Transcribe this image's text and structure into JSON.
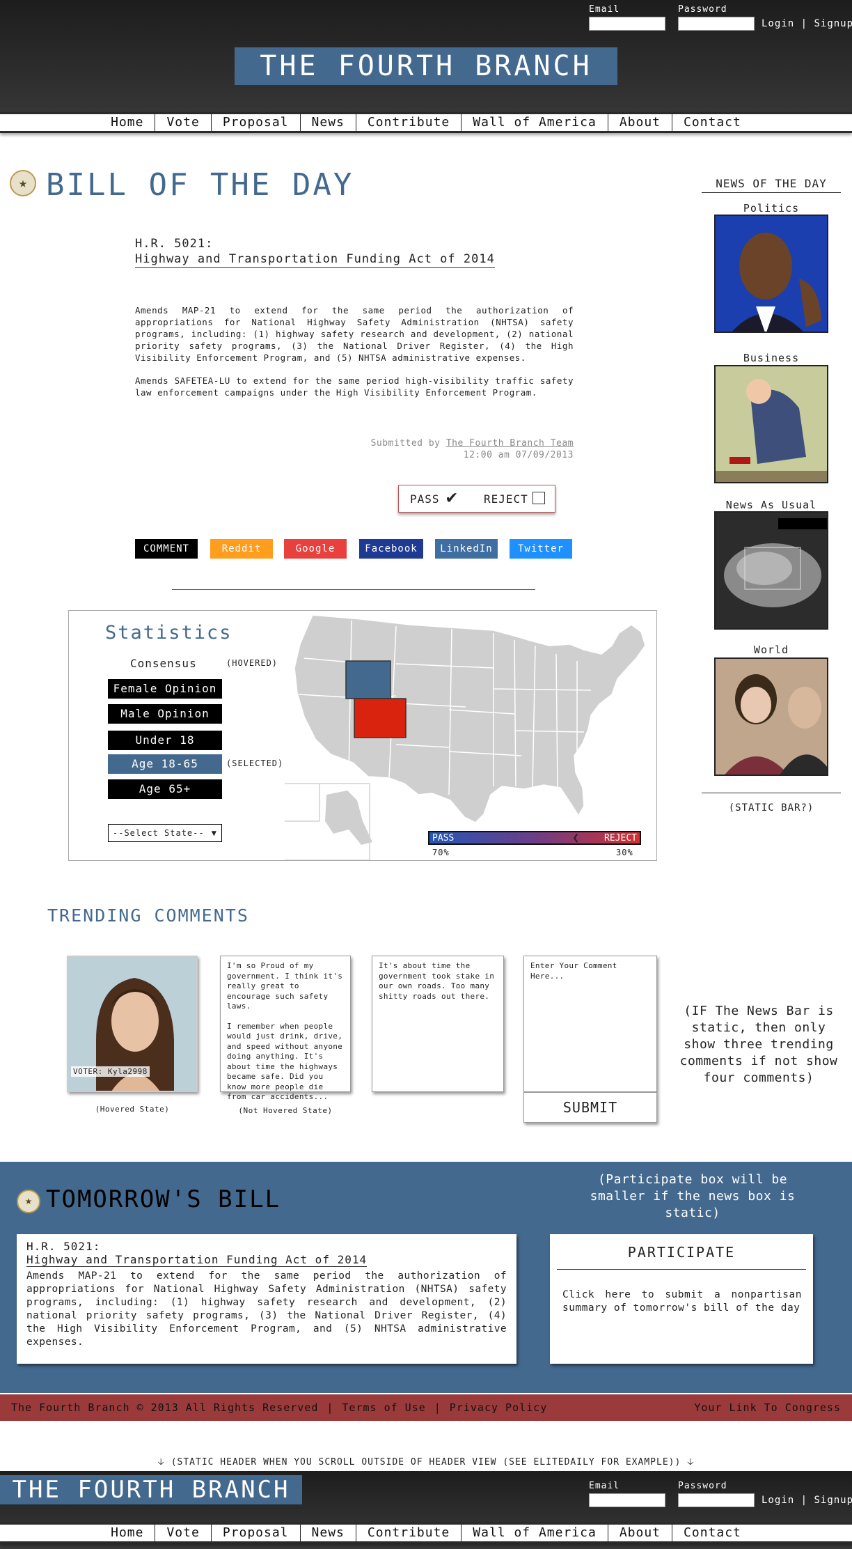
{
  "header": {
    "email_label": "Email",
    "password_label": "Password",
    "login_label": "Login",
    "separator": "|",
    "signup_label": "Signup",
    "logo": "THE FOURTH BRANCH"
  },
  "nav": [
    "Home",
    "Vote",
    "Proposal",
    "News",
    "Contribute",
    "Wall of America",
    "About",
    "Contact"
  ],
  "bill_of_day": {
    "title": "BILL OF THE DAY",
    "number": "H.R. 5021:",
    "name": "Highway and Transportation Funding Act of 2014",
    "paragraph1": "Amends MAP-21 to extend for the same period the authorization of appropriations for National Highway Safety Administration (NHTSA) safety programs, including: (1) highway safety research and development, (2) national priority safety programs, (3) the National Driver Register, (4) the High Visibility Enforcement Program, and (5) NHTSA administrative expenses.",
    "paragraph2": "Amends SAFETEA-LU to extend for the same period high-visibility traffic safety law enforcement campaigns under the High Visibility Enforcement Program.",
    "submitted_prefix": "Submitted by",
    "submitted_by": "The Fourth Branch Team",
    "submitted_time": "12:00 am 07/09/2013",
    "pass_label": "PASS",
    "reject_label": "REJECT",
    "pass_checked": true,
    "reject_checked": false
  },
  "share": {
    "comment": "COMMENT",
    "reddit": "Reddit",
    "google": "Google",
    "facebook": "Facebook",
    "linkedin": "LinkedIn",
    "twitter": "Twitter",
    "colors": {
      "comment": "#000000",
      "reddit": "#ff9d1e",
      "google": "#e8403d",
      "facebook": "#1f3a93",
      "linkedin": "#3f6ea3",
      "twitter": "#1e90ff"
    }
  },
  "statistics": {
    "title": "Statistics",
    "consensus": "Consensus",
    "hovered_note": "(HOVERED)",
    "selected_note": "(SELECTED)",
    "buttons": [
      "Female Opinion",
      "Male Opinion",
      "Under 18",
      "Age 18-65",
      "Age 65+"
    ],
    "selected_button": "Age 18-65",
    "state_select": "--Select State--",
    "pass_label": "PASS",
    "reject_label": "REJECT",
    "pass_pct": "70%",
    "reject_pct": "30%",
    "pass_value": 0.7,
    "highlight_states": {
      "Wyoming": "#44698f",
      "Colorado": "#d9230f"
    }
  },
  "trending": {
    "title": "TRENDING COMMENTS",
    "voter_tag": "VOTER: Kyla2998",
    "hovered_caption": "(Hovered State)",
    "not_hovered_caption": "(Not Hovered State)",
    "comment1_p1": "I'm so Proud of my government. I think it's really great to encourage such safety laws.",
    "comment1_p2": "I remember when people would just drink, drive, and speed without anyone doing anything. It's about time the highways became safe. Did you know more people die from car accidents...",
    "comment2": "It's about time the government took stake in our own roads. Too many shitty roads out there.",
    "input_placeholder": "Enter Your Comment Here...",
    "submit": "SUBMIT",
    "side_note": "(IF The News Bar is static, then only show three trending comments if not show four comments)"
  },
  "tomorrow": {
    "title": "TOMORROW'S BILL",
    "note": "(Participate box will be smaller if the news box is static)",
    "number": "H.R. 5021:",
    "name": "Highway and Transportation Funding Act of 2014",
    "text": "Amends MAP-21 to extend for the same period the authorization of appropriations for National Highway Safety Administration (NHTSA) safety programs, including: (1) highway safety research and development, (2) national priority safety programs, (3) the National Driver Register, (4) the High Visibility Enforcement Program, and (5) NHTSA administrative expenses.",
    "participate_title": "PARTICIPATE",
    "participate_text": "Click here to submit a nonpartisan summary of tomorrow's bill of the day"
  },
  "footer": {
    "copyright": "The Fourth Branch © 2013 All Rights Reserved",
    "terms": "Terms of Use",
    "privacy": "Privacy Policy",
    "separator": "|",
    "congress": "Your Link To Congress"
  },
  "static_header_note": "(STATIC HEADER WHEN YOU SCROLL OUTSIDE OF HEADER VIEW (SEE ELITEDAILY FOR EXAMPLE))",
  "news": {
    "title": "NEWS OF THE DAY",
    "items": [
      "Politics",
      "Business",
      "News As Usual",
      "World"
    ],
    "static_bar_note": "(STATIC BAR?)"
  }
}
